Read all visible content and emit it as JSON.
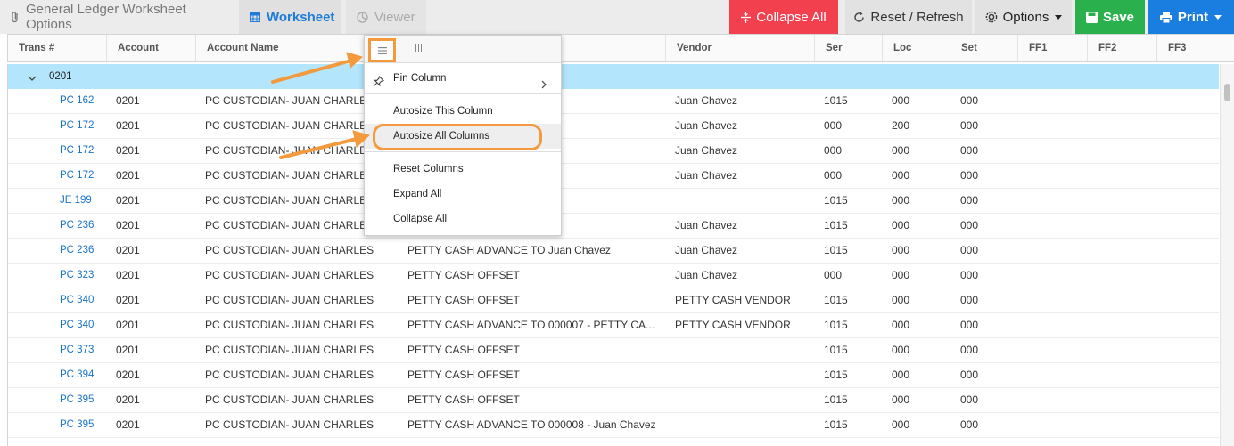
{
  "toolbar": {
    "tabs": {
      "options": "General Ledger Worksheet Options",
      "worksheet": "Worksheet",
      "viewer": "Viewer"
    },
    "buttons": {
      "collapse_all": "Collapse All",
      "reset_refresh": "Reset / Refresh",
      "options": "Options",
      "save": "Save",
      "print": "Print"
    }
  },
  "grid": {
    "columns": {
      "trans": "Trans #",
      "account": "Account",
      "account_name": "Account Name",
      "vendor": "Vendor",
      "ser": "Ser",
      "loc": "Loc",
      "set": "Set",
      "ff1": "FF1",
      "ff2": "FF2",
      "ff3": "FF3"
    },
    "group_label": "0201",
    "rows": [
      {
        "trans": "PC 162",
        "account": "0201",
        "account_name": "PC CUSTODIAN- JUAN CHARLES",
        "description": "",
        "vendor": "Juan Chavez",
        "ser": "1015",
        "loc": "000",
        "set": "000"
      },
      {
        "trans": "PC 172",
        "account": "0201",
        "account_name": "PC CUSTODIAN- JUAN CHARLES",
        "description": "",
        "vendor": "Juan Chavez",
        "ser": "000",
        "loc": "200",
        "set": "000"
      },
      {
        "trans": "PC 172",
        "account": "0201",
        "account_name": "PC CUSTODIAN- JUAN CHARLES",
        "description": "",
        "vendor": "Juan Chavez",
        "ser": "000",
        "loc": "000",
        "set": "000"
      },
      {
        "trans": "PC 172",
        "account": "0201",
        "account_name": "PC CUSTODIAN- JUAN CHARLES",
        "description": "",
        "vendor": "Juan Chavez",
        "ser": "000",
        "loc": "000",
        "set": "000"
      },
      {
        "trans": "JE 199",
        "account": "0201",
        "account_name": "PC CUSTODIAN- JUAN CHARLES",
        "description": "",
        "vendor": "",
        "ser": "1015",
        "loc": "000",
        "set": "000"
      },
      {
        "trans": "PC 236",
        "account": "0201",
        "account_name": "PC CUSTODIAN- JUAN CHARLES",
        "description": "",
        "vendor": "Juan Chavez",
        "ser": "1015",
        "loc": "000",
        "set": "000"
      },
      {
        "trans": "PC 236",
        "account": "0201",
        "account_name": "PC CUSTODIAN- JUAN CHARLES",
        "description": "PETTY CASH ADVANCE TO Juan Chavez",
        "vendor": "Juan Chavez",
        "ser": "1015",
        "loc": "000",
        "set": "000"
      },
      {
        "trans": "PC 323",
        "account": "0201",
        "account_name": "PC CUSTODIAN- JUAN CHARLES",
        "description": "PETTY CASH OFFSET",
        "vendor": "Juan Chavez",
        "ser": "000",
        "loc": "000",
        "set": "000"
      },
      {
        "trans": "PC 340",
        "account": "0201",
        "account_name": "PC CUSTODIAN- JUAN CHARLES",
        "description": "PETTY CASH OFFSET",
        "vendor": "PETTY CASH VENDOR",
        "ser": "1015",
        "loc": "000",
        "set": "000"
      },
      {
        "trans": "PC 340",
        "account": "0201",
        "account_name": "PC CUSTODIAN- JUAN CHARLES",
        "description": "PETTY CASH ADVANCE TO 000007 - PETTY CA...",
        "vendor": "PETTY CASH VENDOR",
        "ser": "1015",
        "loc": "000",
        "set": "000"
      },
      {
        "trans": "PC 373",
        "account": "0201",
        "account_name": "PC CUSTODIAN- JUAN CHARLES",
        "description": "PETTY CASH OFFSET",
        "vendor": "",
        "ser": "1015",
        "loc": "000",
        "set": "000"
      },
      {
        "trans": "PC 394",
        "account": "0201",
        "account_name": "PC CUSTODIAN- JUAN CHARLES",
        "description": "PETTY CASH OFFSET",
        "vendor": "",
        "ser": "1015",
        "loc": "000",
        "set": "000"
      },
      {
        "trans": "PC 395",
        "account": "0201",
        "account_name": "PC CUSTODIAN- JUAN CHARLES",
        "description": "PETTY CASH OFFSET",
        "vendor": "",
        "ser": "1015",
        "loc": "000",
        "set": "000"
      },
      {
        "trans": "PC 395",
        "account": "0201",
        "account_name": "PC CUSTODIAN- JUAN CHARLES",
        "description": "PETTY CASH ADVANCE TO 000008 - Juan Chavez",
        "vendor": "",
        "ser": "1015",
        "loc": "000",
        "set": "000"
      }
    ]
  },
  "column_menu": {
    "items": {
      "pin_column": "Pin Column",
      "autosize_this": "Autosize This Column",
      "autosize_all": "Autosize All Columns",
      "reset_columns": "Reset Columns",
      "expand_all": "Expand All",
      "collapse_all": "Collapse All"
    }
  },
  "colors": {
    "accent_blue": "#1a7de0",
    "collapse_red": "#f2404f",
    "save_green": "#2bb04e",
    "group_row": "#b3e5fc",
    "annotation_orange": "#f39a3e",
    "link_blue": "#1a73c8"
  },
  "icons": {
    "options_tab": "paperclip-icon",
    "worksheet_tab": "table-icon",
    "viewer_tab": "pie-chart-icon",
    "collapse_all": "collapse-icon",
    "reset_refresh": "refresh-icon",
    "options": "gear-icon",
    "save": "save-icon",
    "print": "print-icon",
    "menu_general": "hamburger-icon",
    "menu_columns": "columns-icon",
    "pin": "pin-icon"
  }
}
